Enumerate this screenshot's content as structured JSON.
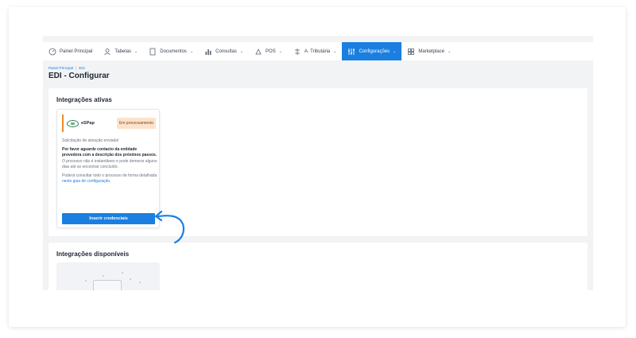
{
  "nav": {
    "items": [
      {
        "label": "Painel Principal",
        "icon": "dashboard-icon",
        "has_chevron": false
      },
      {
        "label": "Tabelas",
        "icon": "users-icon",
        "has_chevron": true
      },
      {
        "label": "Documentos",
        "icon": "document-icon",
        "has_chevron": true
      },
      {
        "label": "Consultas",
        "icon": "bar-chart-icon",
        "has_chevron": true
      },
      {
        "label": "POS",
        "icon": "pos-icon",
        "has_chevron": true
      },
      {
        "label": "A. Tributária",
        "icon": "tax-icon",
        "has_chevron": true
      },
      {
        "label": "Configurações",
        "icon": "settings-icon",
        "has_chevron": true,
        "active": true
      },
      {
        "label": "Marketplace",
        "icon": "marketplace-icon",
        "has_chevron": true
      }
    ]
  },
  "breadcrumb": {
    "root": "Painel Principal",
    "separator": "|",
    "current": "EDI"
  },
  "page": {
    "title": "EDI - Configurar"
  },
  "active_integrations": {
    "title": "Integrações ativas",
    "card": {
      "logo_text": "eSPap",
      "status": "Em processamento",
      "line1": "Solicitação de ativação enviada!",
      "line2_bold": "Por favor aguarde contacto da entidade provedora com a descrição dos próximos passos.",
      "line3": "O processo não é instantâneo e pode demorar alguns dias até se encontrar concluído.",
      "line4_prefix": "Poderá consultar todo o processo de forma detalhada",
      "line4_link": "neste guia de configuração",
      "line4_suffix": ".",
      "button": "Inserir credenciais"
    }
  },
  "available_integrations": {
    "title": "Integrações disponíveis"
  },
  "colors": {
    "accent": "#1a7fe0",
    "status_bg": "#fde3cc",
    "status_border": "#f08a24"
  }
}
